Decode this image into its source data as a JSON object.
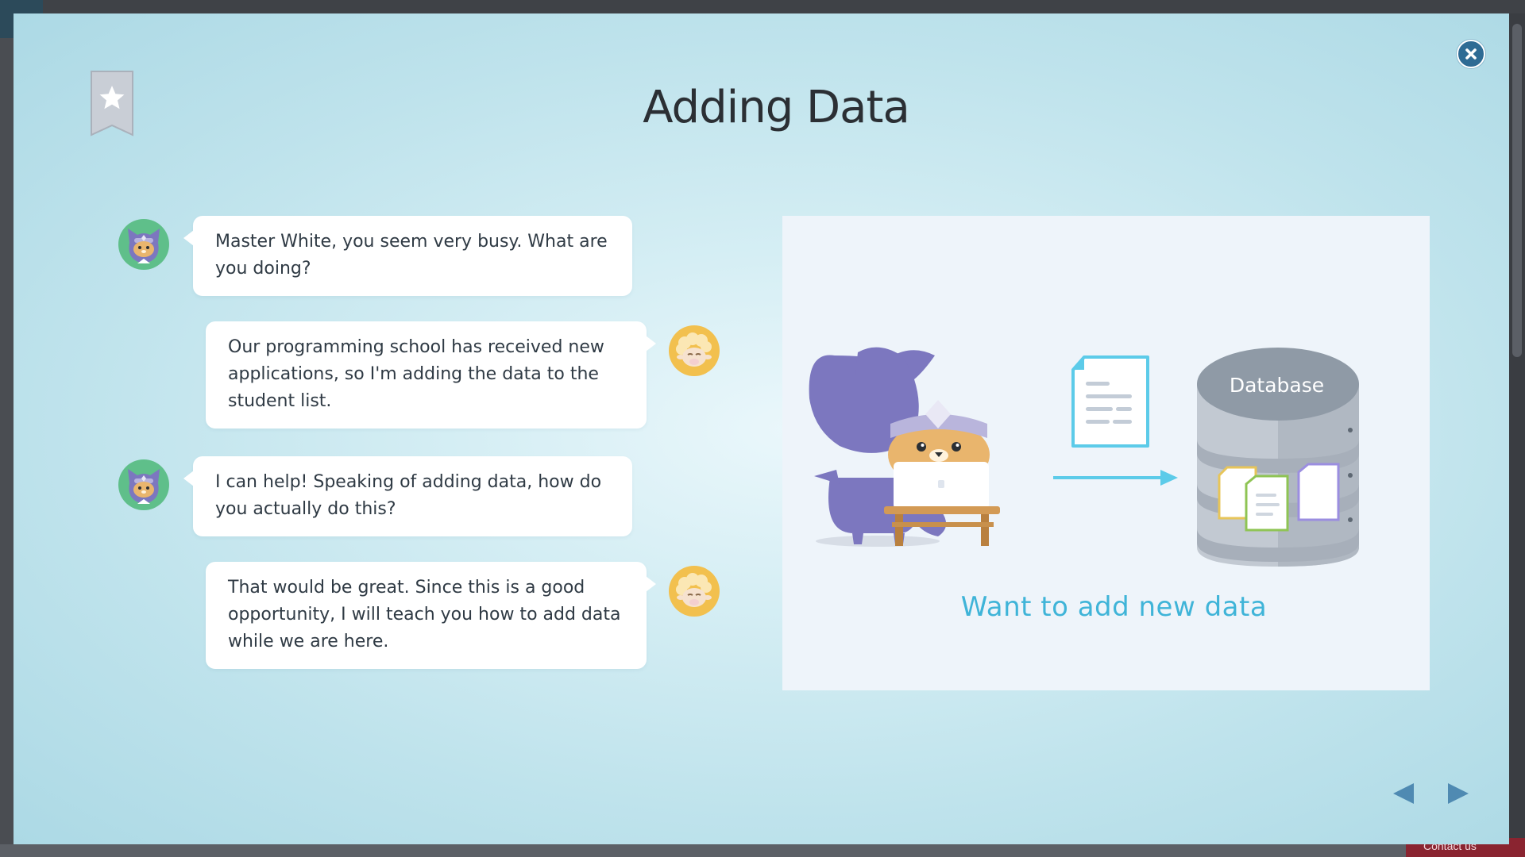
{
  "lesson": {
    "title": "Adding Data"
  },
  "conversation": [
    {
      "speaker": "ninja-cat",
      "side": "left",
      "text": "Master White, you seem very busy. What are you doing?"
    },
    {
      "speaker": "master-white",
      "side": "right",
      "text": "Our programming school has received new applications, so I'm adding the data to the student list."
    },
    {
      "speaker": "ninja-cat",
      "side": "left",
      "text": "I can help! Speaking of adding data, how do you actually do this?"
    },
    {
      "speaker": "master-white",
      "side": "right",
      "text": "That would be great. Since this is a good opportunity, I will teach you how to add data while we are here."
    }
  ],
  "illustration": {
    "database_label": "Database",
    "caption": "Want to add new data"
  },
  "footer": {
    "contact_label": "Contact us"
  },
  "icons": {
    "close": "close-icon",
    "bookmark": "bookmark-star-icon",
    "prev": "triangle-left-icon",
    "next": "triangle-right-icon"
  },
  "colors": {
    "accent": "#2e6b94",
    "caption": "#3fb4d8",
    "nav": "#4f8ab2",
    "ninja_purple": "#7c77bf",
    "avatar_green": "#5fbf8a",
    "avatar_yellow": "#f2c04e"
  }
}
